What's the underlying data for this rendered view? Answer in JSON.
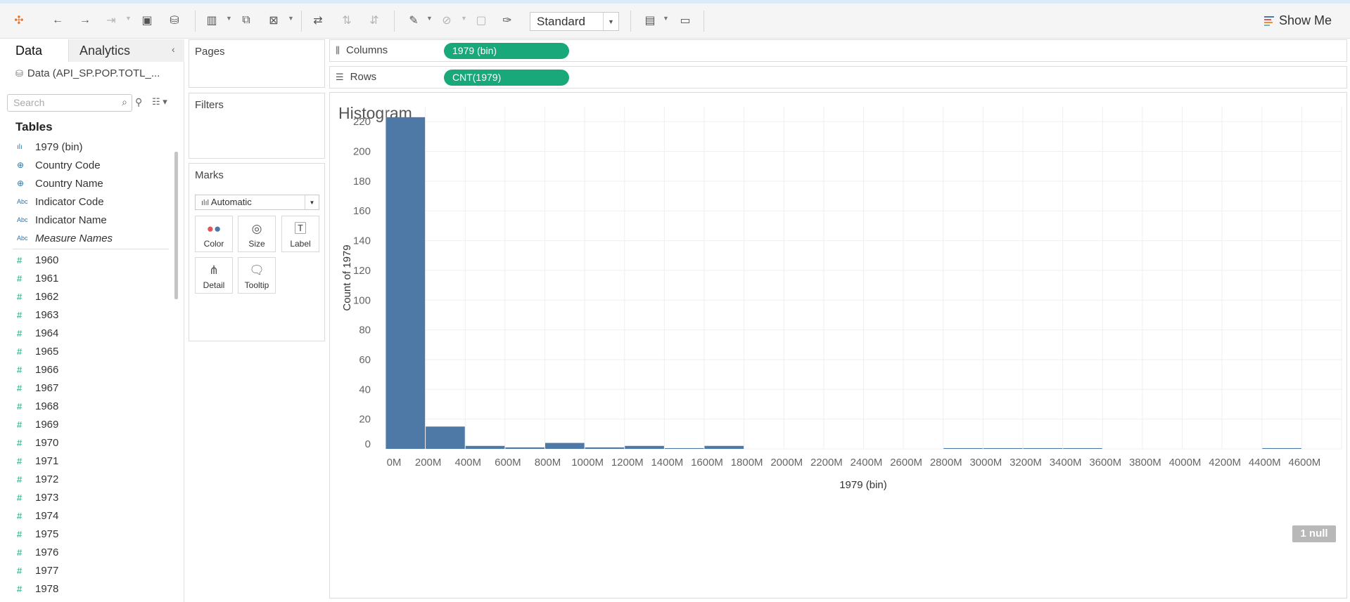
{
  "toolbar": {
    "view_select": "Standard",
    "show_me_label": "Show Me",
    "icons": [
      "tableau-logo-icon",
      "undo-icon",
      "redo-icon",
      "replay-icon",
      "save-icon",
      "new-datasource-icon",
      "new-worksheet-icon",
      "duplicate-sheet-icon",
      "clear-sheet-icon",
      "swap-rows-columns-icon",
      "sort-ascending-icon",
      "sort-descending-icon",
      "highlight-icon",
      "group-icon",
      "label-icon",
      "pin-icon",
      "show-hide-cards-icon",
      "presentation-icon"
    ]
  },
  "left_panel": {
    "tab_data": "Data",
    "tab_analytics": "Analytics",
    "datasource": "Data (API_SP.POP.TOTL_...",
    "search_placeholder": "Search",
    "tables_heading": "Tables",
    "dimensions": [
      {
        "label": "1979 (bin)",
        "type": "bin"
      },
      {
        "label": "Country Code",
        "type": "geo"
      },
      {
        "label": "Country Name",
        "type": "geo"
      },
      {
        "label": "Indicator Code",
        "type": "abc"
      },
      {
        "label": "Indicator Name",
        "type": "abc"
      },
      {
        "label": "Measure Names",
        "type": "abc"
      }
    ],
    "measures": [
      "1960",
      "1961",
      "1962",
      "1963",
      "1964",
      "1965",
      "1966",
      "1967",
      "1968",
      "1969",
      "1970",
      "1971",
      "1972",
      "1973",
      "1974",
      "1975",
      "1976",
      "1977",
      "1978"
    ]
  },
  "cards": {
    "pages": "Pages",
    "filters": "Filters",
    "marks": "Marks",
    "mark_type": "Automatic",
    "mark_buttons": [
      "Color",
      "Size",
      "Label",
      "Detail",
      "Tooltip"
    ]
  },
  "shelves": {
    "columns_label": "Columns",
    "columns_pill": "1979 (bin)",
    "rows_label": "Rows",
    "rows_pill": "CNT(1979)"
  },
  "view": {
    "null_badge": "1 null"
  },
  "chart_data": {
    "type": "bar",
    "title": "Histogram",
    "xlabel": "1979 (bin)",
    "ylabel": "Count of 1979",
    "categories": [
      "0M",
      "200M",
      "400M",
      "600M",
      "800M",
      "1000M",
      "1200M",
      "1400M",
      "1600M",
      "1800M",
      "2000M",
      "2200M",
      "2400M",
      "2600M",
      "2800M",
      "3000M",
      "3200M",
      "3400M",
      "3600M",
      "3800M",
      "4000M",
      "4200M",
      "4400M",
      "4600M"
    ],
    "values": [
      223,
      15,
      2,
      1,
      4,
      1,
      2,
      0.5,
      2,
      0,
      0,
      0,
      0,
      0,
      0.5,
      0.5,
      0.5,
      0.5,
      0,
      0,
      0,
      0,
      0.5,
      0
    ],
    "ylim": [
      0,
      230
    ],
    "yticks": [
      0,
      20,
      40,
      60,
      80,
      100,
      120,
      140,
      160,
      180,
      200,
      220
    ],
    "bar_color": "#4e79a7",
    "grid": true
  }
}
